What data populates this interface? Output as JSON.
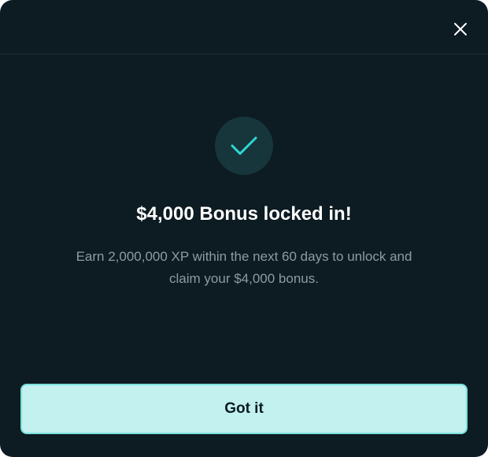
{
  "modal": {
    "close_icon": "close-icon",
    "success_icon": "checkmark-icon",
    "title": "$4,000 Bonus locked in!",
    "description": "Earn 2,000,000 XP within the next 60 days to unlock and claim your $4,000 bonus.",
    "confirm_label": "Got it"
  },
  "colors": {
    "background": "#0d1b22",
    "accent": "#2fd9d4",
    "button_background": "#c2f1ef",
    "button_border": "#7ce1dc",
    "description_text": "#8e9ba1"
  }
}
